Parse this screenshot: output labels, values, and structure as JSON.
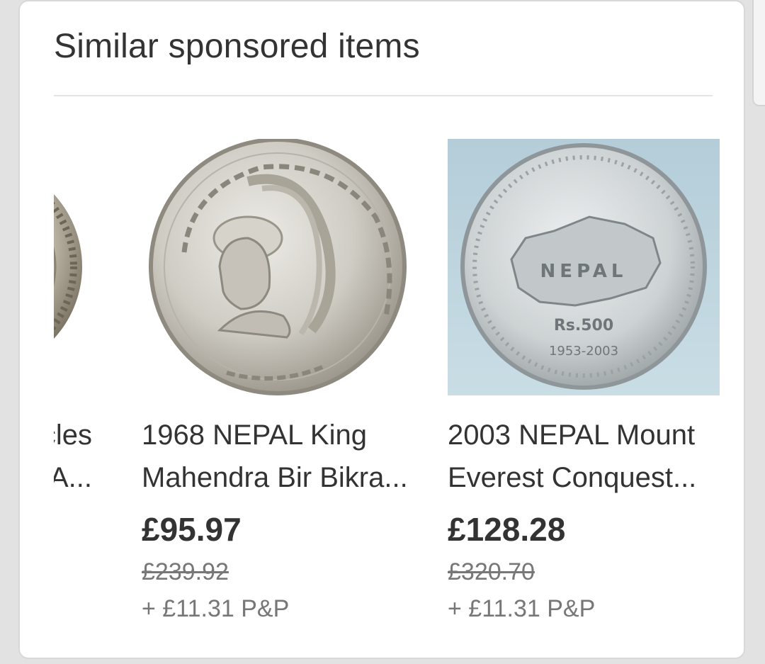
{
  "section": {
    "title": "Similar sponsored items"
  },
  "items": [
    {
      "title_line1": "cles",
      "title_line2": "e A...",
      "image_icon": "coin-icon"
    },
    {
      "title_line1": "1968 NEPAL King",
      "title_line2": "Mahendra Bir Bikra...",
      "price": "£95.97",
      "was_price": "£239.92",
      "postage": "+ £11.31 P&P",
      "image_icon": "coin-icon"
    },
    {
      "title_line1": "2003 NEPAL Mount",
      "title_line2": "Everest Conquest...",
      "price": "£128.28",
      "was_price": "£320.70",
      "postage": "+ £11.31 P&P",
      "image_icon": "coin-icon"
    }
  ],
  "colors": {
    "background": "#e2e2e2",
    "card": "#ffffff",
    "text": "#333333",
    "secondary_text": "#777777",
    "divider": "#e4e4e4",
    "photo_backdrop": "#b9d2dc"
  }
}
